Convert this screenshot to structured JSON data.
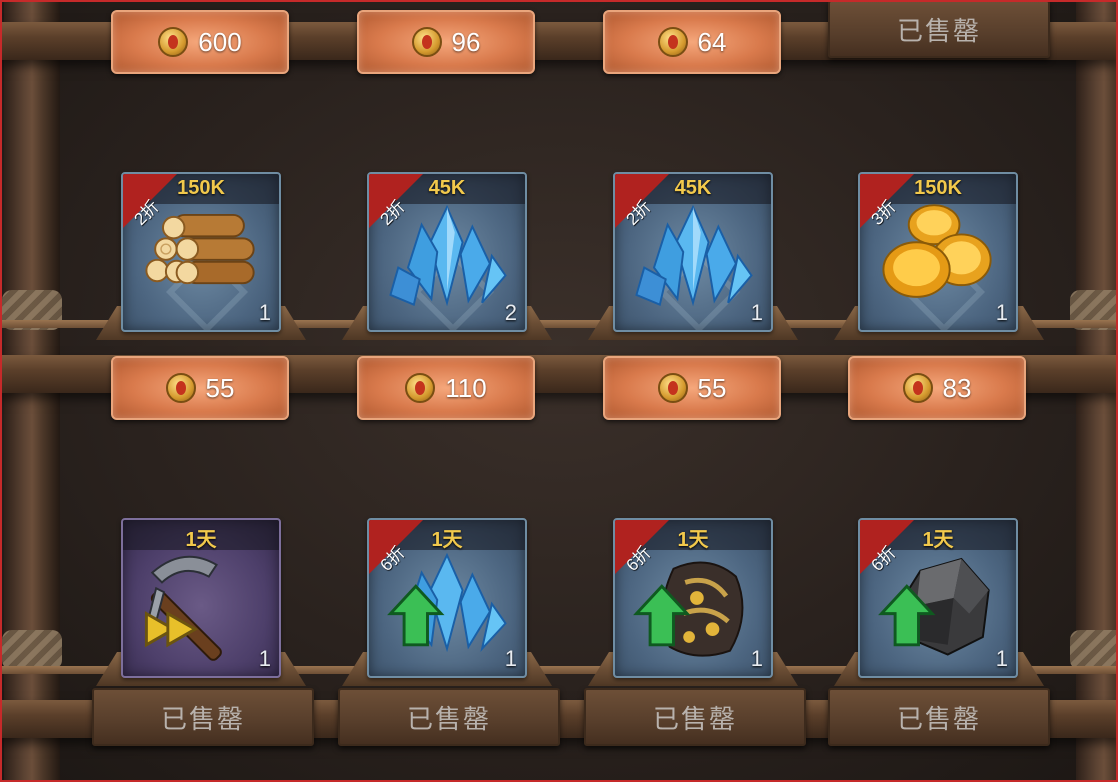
{
  "top_row": {
    "prices": [
      {
        "value": "600"
      },
      {
        "value": "96"
      },
      {
        "value": "64"
      }
    ],
    "sold_label": "已售罄"
  },
  "middle_row": {
    "items": [
      {
        "name": "wood-logs",
        "discount": "2折",
        "amount": "150K",
        "count": "1",
        "price": "55"
      },
      {
        "name": "blue-crystal",
        "discount": "2折",
        "amount": "45K",
        "count": "2",
        "price": "110"
      },
      {
        "name": "blue-crystal",
        "discount": "2折",
        "amount": "45K",
        "count": "1",
        "price": "55"
      },
      {
        "name": "gold-coins",
        "discount": "3折",
        "amount": "150K",
        "count": "1",
        "price": "83"
      }
    ]
  },
  "bottom_row": {
    "items": [
      {
        "name": "pickaxe-boost",
        "discount": "",
        "amount": "1天",
        "count": "1",
        "status": "已售罄"
      },
      {
        "name": "crystal-boost",
        "discount": "6折",
        "amount": "1天",
        "count": "1",
        "status": "已售罄"
      },
      {
        "name": "gold-boost",
        "discount": "6折",
        "amount": "1天",
        "count": "1",
        "status": "已售罄"
      },
      {
        "name": "stone-boost",
        "discount": "6折",
        "amount": "1天",
        "count": "1",
        "status": "已售罄"
      }
    ]
  },
  "colors": {
    "price_button": "#d97a4c",
    "amount_text": "#f2c94c",
    "discount_ribbon": "#b0221f",
    "slot_blue": "#4c6580",
    "slot_purple": "#4d3f6a"
  }
}
